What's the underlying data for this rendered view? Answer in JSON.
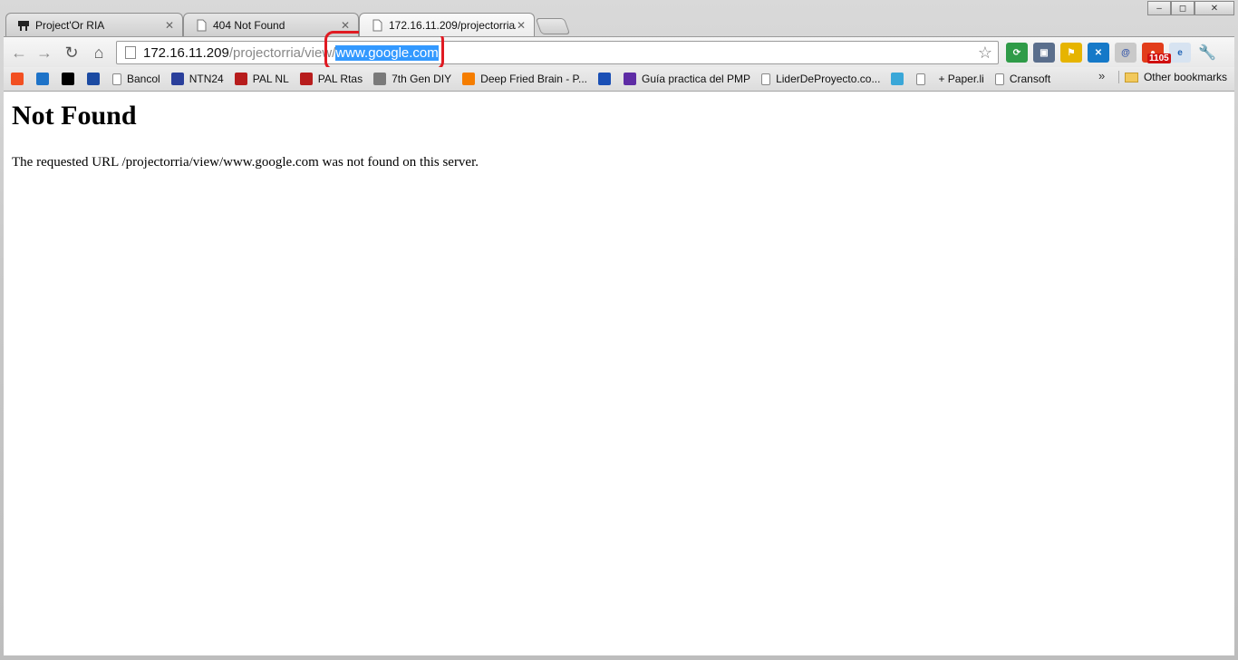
{
  "window_controls": {
    "minimize": "–",
    "maximize": "◻",
    "close": "✕"
  },
  "tabs": [
    {
      "title": "Project'Or RIA",
      "active": false
    },
    {
      "title": "404 Not Found",
      "active": false
    },
    {
      "title": "172.16.11.209/projectorria/",
      "active": true
    }
  ],
  "omnibox": {
    "host": "172.16.11.209",
    "path": "/projectorria/view/",
    "selected": "www.google.com"
  },
  "extension_badge": "1105",
  "bookmarks": [
    {
      "label": "",
      "icon": "windows-icon",
      "color": "#f25022"
    },
    {
      "label": "",
      "icon": "calendar-16-icon",
      "color": "#1e73c8"
    },
    {
      "label": "",
      "icon": "bbc-icon",
      "color": "#000000"
    },
    {
      "label": "",
      "icon": "citi-icon",
      "color": "#1b4aa2"
    },
    {
      "label": "Bancol",
      "icon": "page-icon",
      "color": ""
    },
    {
      "label": "NTN24",
      "icon": "ntn24-icon",
      "color": "#2a3f9b"
    },
    {
      "label": "PAL NL",
      "icon": "pal-icon",
      "color": "#b71c1c"
    },
    {
      "label": "PAL Rtas",
      "icon": "pal-icon",
      "color": "#b71c1c"
    },
    {
      "label": "7th Gen DIY",
      "icon": "house-icon",
      "color": "#7a7a7a"
    },
    {
      "label": "Deep Fried Brain - P...",
      "icon": "blogger-icon",
      "color": "#f57d00"
    },
    {
      "label": "",
      "icon": "e-icon",
      "color": "#1a4fb5"
    },
    {
      "label": "Guía practica del PMP",
      "icon": "c-icon",
      "color": "#5e2ca5"
    },
    {
      "label": "LiderDeProyecto.co...",
      "icon": "page-icon",
      "color": ""
    },
    {
      "label": "",
      "icon": "puzzle-icon",
      "color": "#3aa7d8"
    },
    {
      "label": "",
      "icon": "page-icon",
      "color": ""
    },
    {
      "label": "+ Paper.li",
      "icon": "",
      "color": ""
    },
    {
      "label": "Cransoft",
      "icon": "page-icon",
      "color": ""
    }
  ],
  "bookmarks_more": "»",
  "other_bookmarks": "Other bookmarks",
  "page": {
    "heading": "Not Found",
    "message": "The requested URL /projectorria/view/www.google.com was not found on this server."
  },
  "colors": {
    "highlight": "#e01a22",
    "selection": "#3399ff"
  }
}
